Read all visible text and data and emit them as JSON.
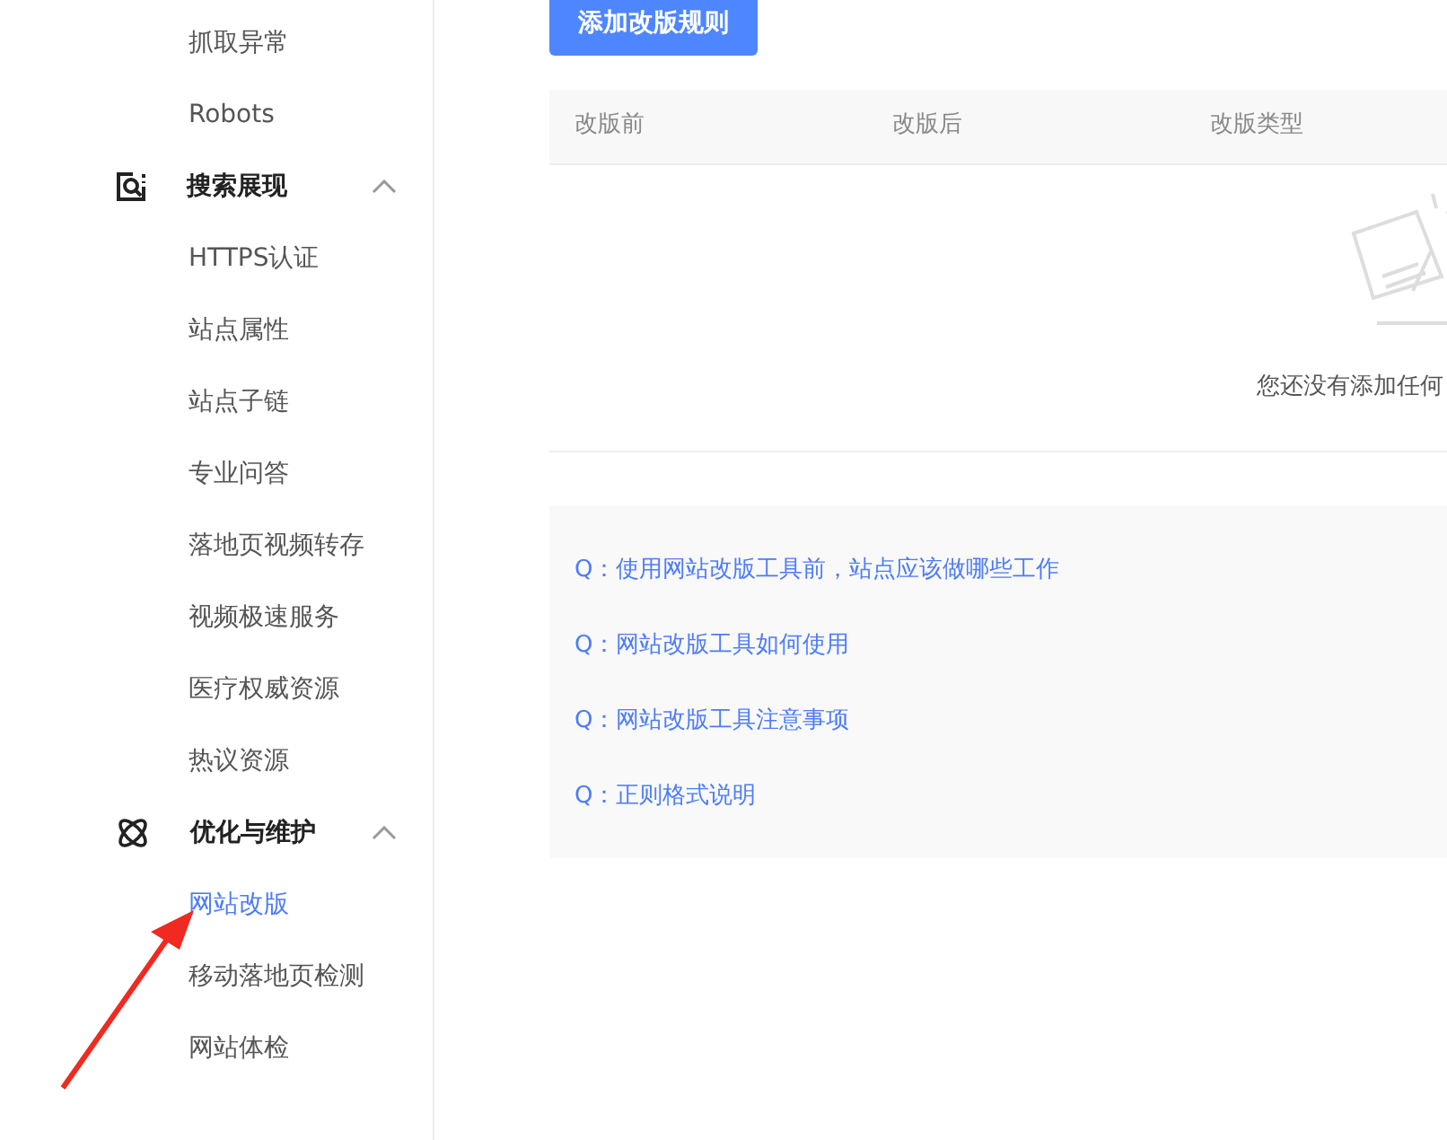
{
  "sidebar": {
    "groups": [
      {
        "items": [
          {
            "label": "抓取异常",
            "selected": false
          },
          {
            "label": "Robots",
            "selected": false
          }
        ]
      },
      {
        "kind": "search",
        "title": "搜索展现",
        "expanded": true,
        "items": [
          {
            "label": "HTTPS认证",
            "selected": false
          },
          {
            "label": "站点属性",
            "selected": false
          },
          {
            "label": "站点子链",
            "selected": false
          },
          {
            "label": "专业问答",
            "selected": false
          },
          {
            "label": "落地页视频转存",
            "selected": false
          },
          {
            "label": "视频极速服务",
            "selected": false
          },
          {
            "label": "医疗权威资源",
            "selected": false
          },
          {
            "label": "热议资源",
            "selected": false
          }
        ]
      },
      {
        "kind": "optimize",
        "title": "优化与维护",
        "expanded": true,
        "items": [
          {
            "label": "网站改版",
            "selected": true
          },
          {
            "label": "移动落地页检测",
            "selected": false
          },
          {
            "label": "网站体检",
            "selected": false
          }
        ]
      }
    ]
  },
  "main": {
    "add_button": "添加改版规则",
    "table": {
      "columns": [
        "改版前",
        "改版后",
        "改版类型"
      ],
      "empty_text": "您还没有添加任何"
    },
    "faq": [
      "Q：使用网站改版工具前，站点应该做哪些工作",
      "Q：网站改版工具如何使用",
      "Q：网站改版工具注意事项",
      "Q：正则格式说明"
    ]
  }
}
